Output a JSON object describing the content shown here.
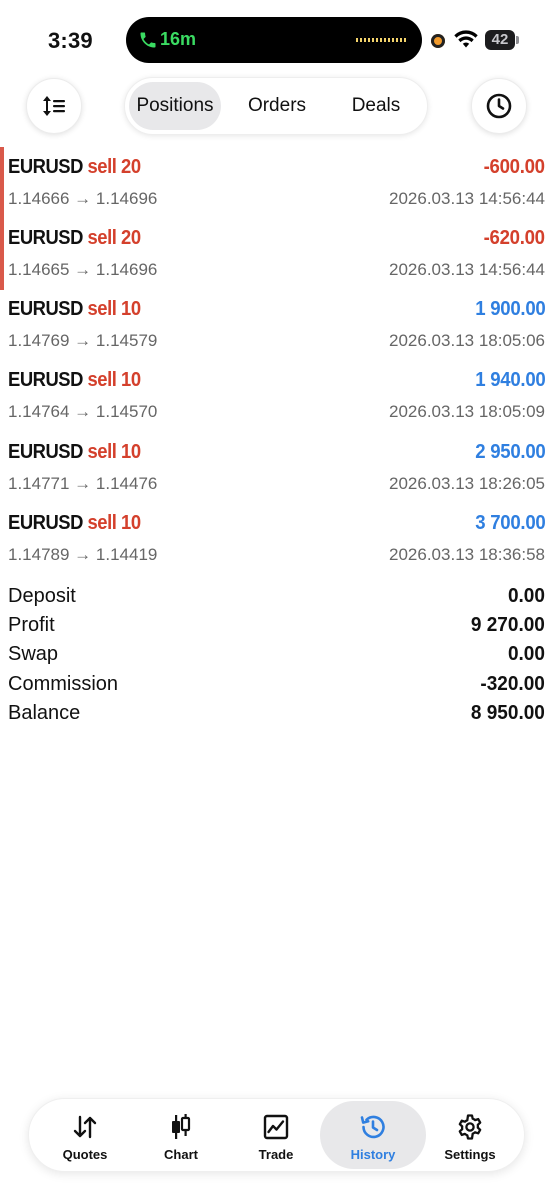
{
  "status_bar": {
    "time": "3:39",
    "call_duration": "16m",
    "battery": "42"
  },
  "toolbar": {
    "segments": [
      {
        "label": "Positions",
        "active": true
      },
      {
        "label": "Orders",
        "active": false
      },
      {
        "label": "Deals",
        "active": false
      }
    ]
  },
  "deals": [
    {
      "symbol": "EURUSD",
      "side": "sell 20",
      "profit": "-600.00",
      "sign": "neg",
      "prices": "1.14666 → 1.14696",
      "time": "2026.03.13 14:56:44",
      "marked": true
    },
    {
      "symbol": "EURUSD",
      "side": "sell 20",
      "profit": "-620.00",
      "sign": "neg",
      "prices": "1.14665 → 1.14696",
      "time": "2026.03.13 14:56:44",
      "marked": true
    },
    {
      "symbol": "EURUSD",
      "side": "sell 10",
      "profit": "1 900.00",
      "sign": "pos",
      "prices": "1.14769 → 1.14579",
      "time": "2026.03.13 18:05:06",
      "marked": false
    },
    {
      "symbol": "EURUSD",
      "side": "sell 10",
      "profit": "1 940.00",
      "sign": "pos",
      "prices": "1.14764 → 1.14570",
      "time": "2026.03.13 18:05:09",
      "marked": false
    },
    {
      "symbol": "EURUSD",
      "side": "sell 10",
      "profit": "2 950.00",
      "sign": "pos",
      "prices": "1.14771 → 1.14476",
      "time": "2026.03.13 18:26:05",
      "marked": false
    },
    {
      "symbol": "EURUSD",
      "side": "sell 10",
      "profit": "3 700.00",
      "sign": "pos",
      "prices": "1.14789 → 1.14419",
      "time": "2026.03.13 18:36:58",
      "marked": false
    }
  ],
  "summary": [
    {
      "label": "Deposit",
      "value": "0.00"
    },
    {
      "label": "Profit",
      "value": "9 270.00"
    },
    {
      "label": "Swap",
      "value": "0.00"
    },
    {
      "label": "Commission",
      "value": "-320.00"
    },
    {
      "label": "Balance",
      "value": "8 950.00"
    }
  ],
  "tabs": [
    {
      "label": "Quotes",
      "icon": "quotes-icon",
      "active": false
    },
    {
      "label": "Chart",
      "icon": "candlestick-icon",
      "active": false
    },
    {
      "label": "Trade",
      "icon": "trade-chart-icon",
      "active": false
    },
    {
      "label": "History",
      "icon": "history-icon",
      "active": true
    },
    {
      "label": "Settings",
      "icon": "gear-icon",
      "active": false
    }
  ],
  "colors": {
    "loss": "#d4402c",
    "gain": "#2f7fe0",
    "active_tab": "#2f7fe0",
    "marker": "#d9594a"
  }
}
